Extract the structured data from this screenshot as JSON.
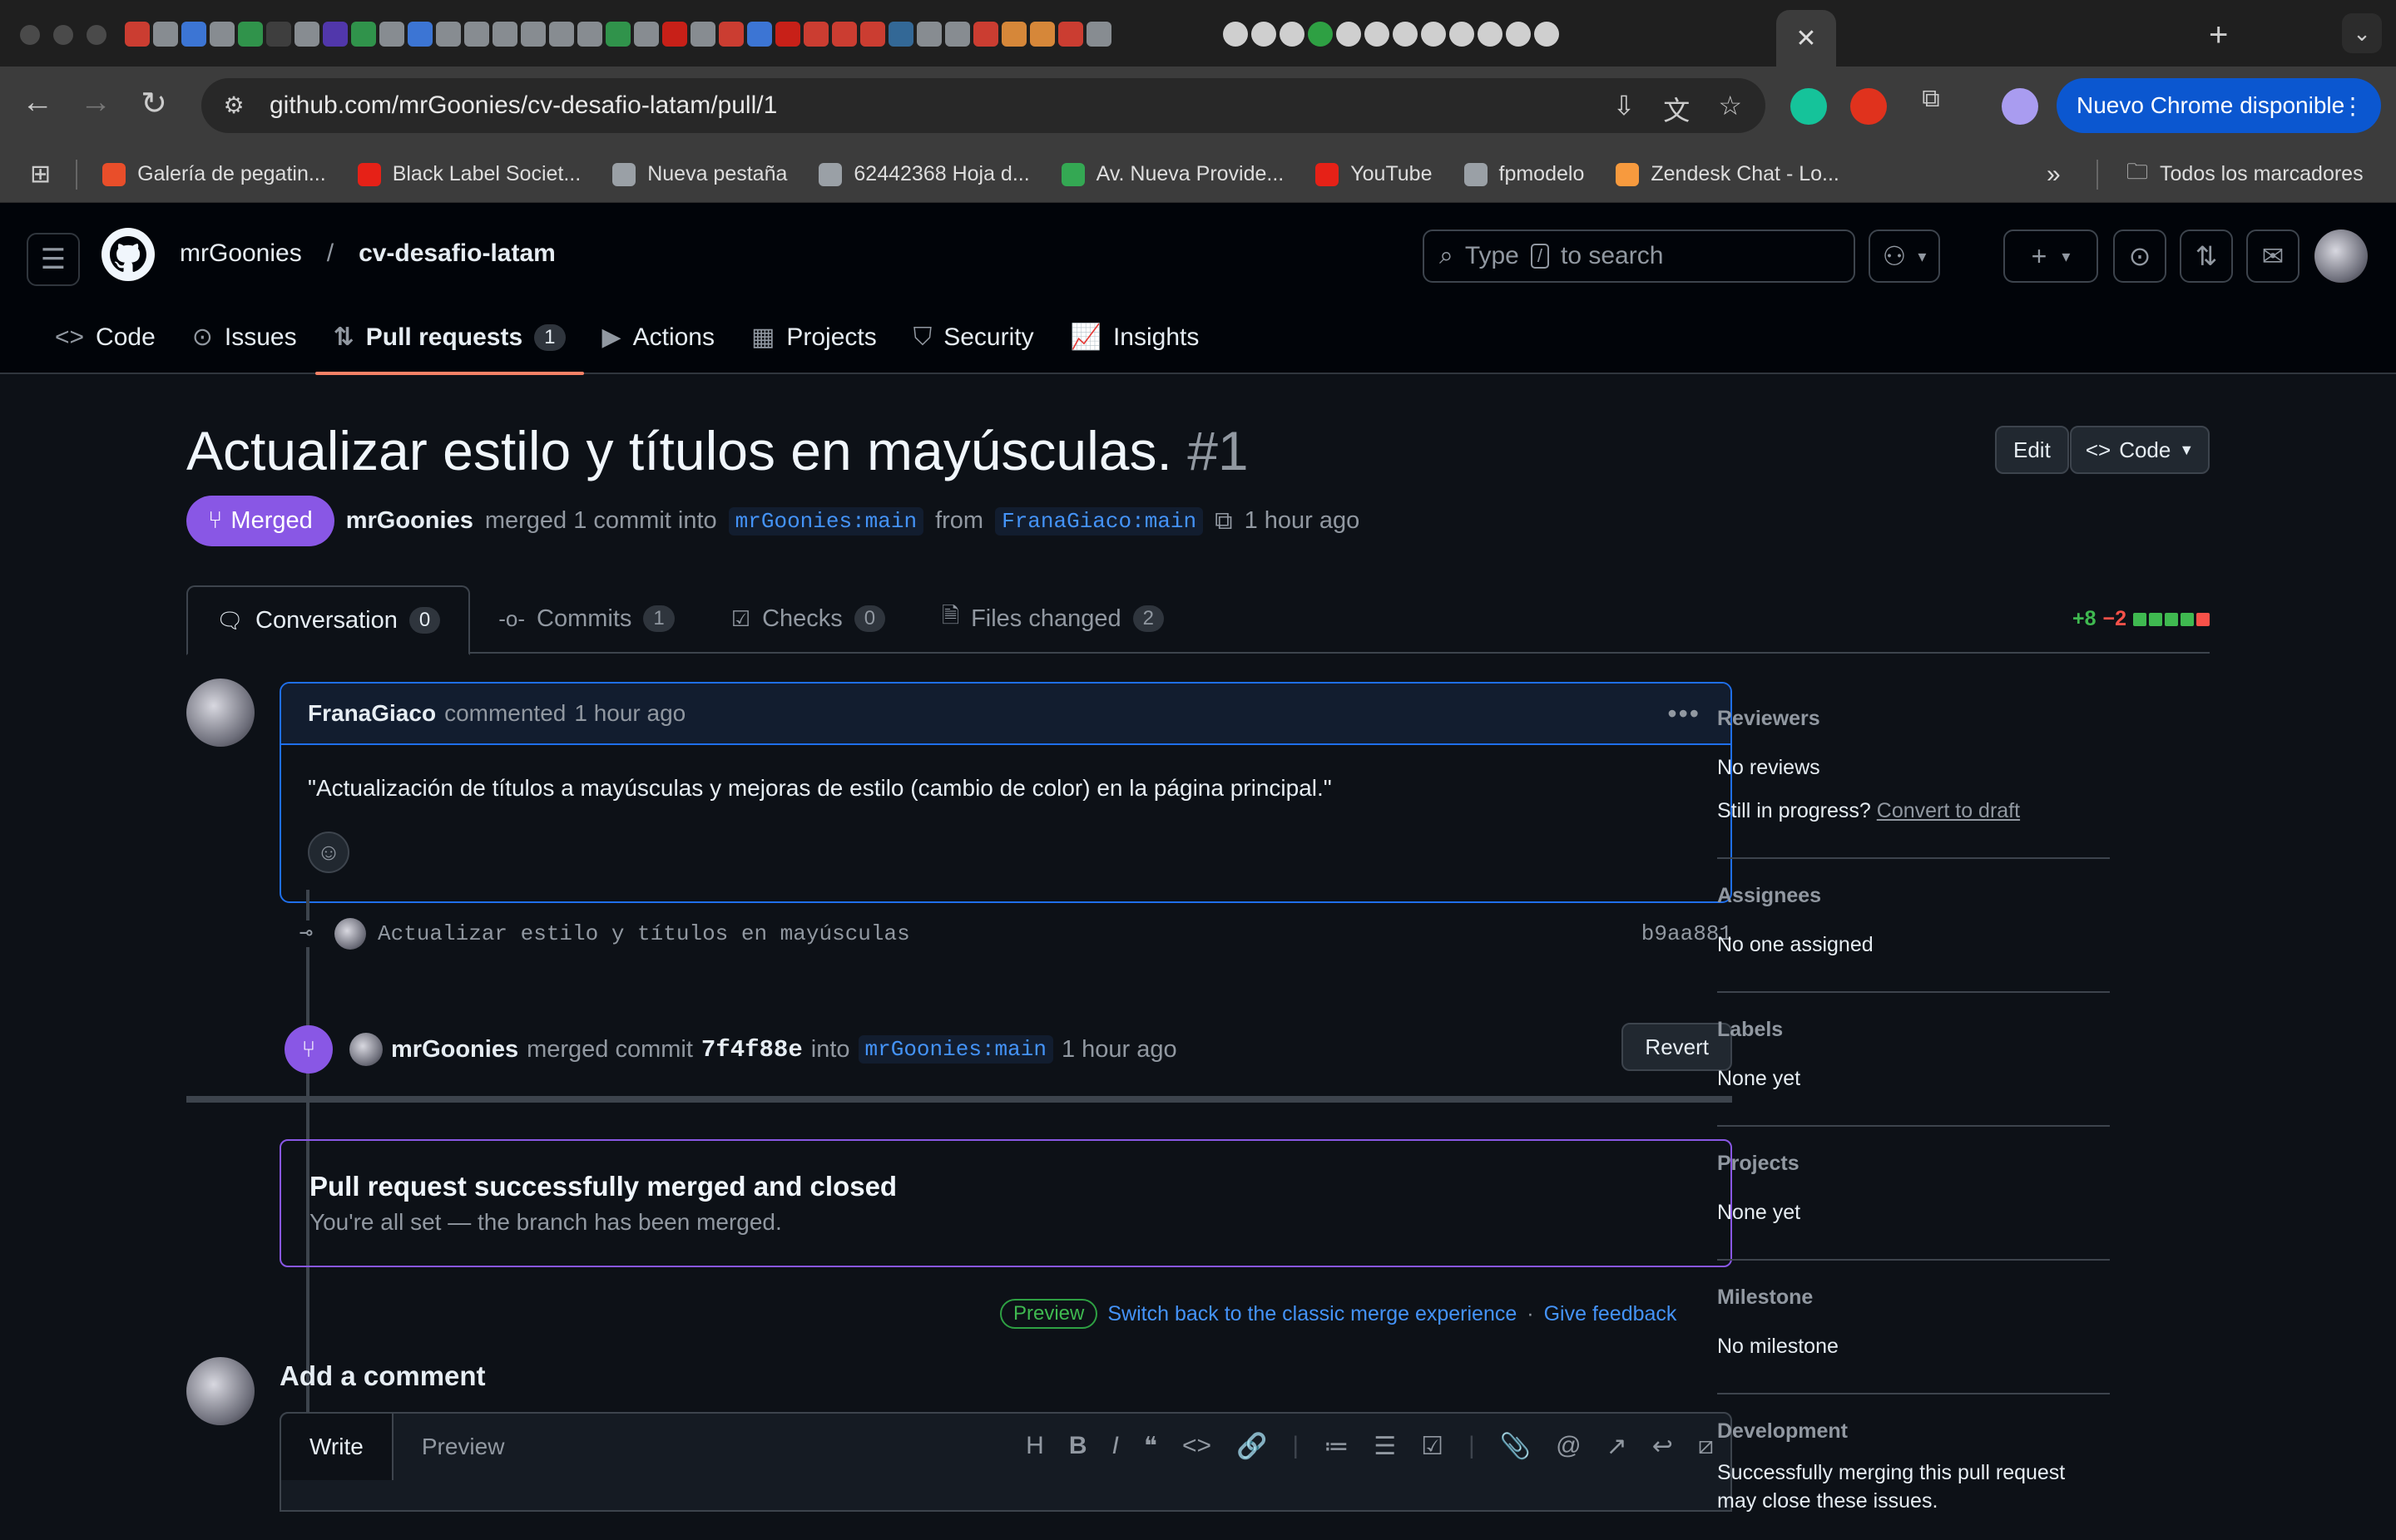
{
  "browser": {
    "url": "github.com/mrGoonies/cv-desafio-latam/pull/1",
    "update_label": "Nuevo Chrome disponible",
    "bookmarks": [
      {
        "label": "Galería de pegatin...",
        "color": "#e94e2a"
      },
      {
        "label": "Black Label Societ...",
        "color": "#e62117"
      },
      {
        "label": "Nueva pestaña",
        "color": "#9aa0a6"
      },
      {
        "label": "62442368 Hoja d...",
        "color": "#9aa0a6"
      },
      {
        "label": "Av. Nueva Provide...",
        "color": "#34a853"
      },
      {
        "label": "YouTube",
        "color": "#e62117"
      },
      {
        "label": "fpmodelo",
        "color": "#9aa0a6"
      },
      {
        "label": "Zendesk Chat - Lo...",
        "color": "#f79a3e"
      }
    ],
    "all_bookmarks": "Todos los marcadores"
  },
  "header": {
    "owner": "mrGoonies",
    "separator": "/",
    "repo": "cv-desafio-latam",
    "search_prefix": "Type",
    "search_key": "/",
    "search_suffix": "to search"
  },
  "repo_nav": [
    {
      "label": "Code",
      "icon": "code-icon",
      "glyph": "<>"
    },
    {
      "label": "Issues",
      "icon": "issue-icon",
      "glyph": "⊙"
    },
    {
      "label": "Pull requests",
      "icon": "pull-request-icon",
      "glyph": "⇅",
      "count": "1",
      "active": true
    },
    {
      "label": "Actions",
      "icon": "play-icon",
      "glyph": "▶"
    },
    {
      "label": "Projects",
      "icon": "table-icon",
      "glyph": "▦"
    },
    {
      "label": "Security",
      "icon": "shield-icon",
      "glyph": "⛉"
    },
    {
      "label": "Insights",
      "icon": "graph-icon",
      "glyph": "📈"
    }
  ],
  "pr": {
    "title": "Actualizar estilo y títulos en mayúsculas.",
    "number": "#1",
    "edit": "Edit",
    "code": "Code",
    "status": "Merged",
    "author": "mrGoonies",
    "merged_text": "merged 1 commit into",
    "base_branch": "mrGoonies:main",
    "from": "from",
    "head_branch": "FranaGiaco:main",
    "time": "1 hour ago"
  },
  "tabs": [
    {
      "label": "Conversation",
      "count": "0",
      "icon": "comment-icon",
      "glyph": "🗨"
    },
    {
      "label": "Commits",
      "count": "1",
      "icon": "commit-icon",
      "glyph": "-o-"
    },
    {
      "label": "Checks",
      "count": "0",
      "icon": "checklist-icon",
      "glyph": "☑"
    },
    {
      "label": "Files changed",
      "count": "2",
      "icon": "file-diff-icon",
      "glyph": "🗎"
    }
  ],
  "diffstat": {
    "added": "+8",
    "removed": "−2"
  },
  "comment": {
    "author": "FranaGiaco",
    "action": "commented",
    "time": "1 hour ago",
    "body": "\"Actualización de títulos a mayúsculas y mejoras de estilo (cambio de color) en la página principal.\""
  },
  "commit": {
    "message": "Actualizar estilo y títulos en mayúsculas",
    "sha": "b9aa881"
  },
  "merge_event": {
    "author": "mrGoonies",
    "text": "merged commit",
    "sha": "7f4f88e",
    "into": "into",
    "branch": "mrGoonies:main",
    "time": "1 hour ago",
    "revert": "Revert"
  },
  "merged_box": {
    "title": "Pull request successfully merged and closed",
    "subtitle": "You're all set — the branch has been merged."
  },
  "preview": {
    "badge": "Preview",
    "link1": "Switch back to the classic merge experience",
    "sep": "·",
    "link2": "Give feedback"
  },
  "add_comment": {
    "title": "Add a comment",
    "write": "Write",
    "preview": "Preview"
  },
  "sidebar": {
    "reviewers_h": "Reviewers",
    "reviewers_v": "No reviews",
    "progress_q": "Still in progress?",
    "convert": "Convert to draft",
    "assignees_h": "Assignees",
    "assignees_v": "No one assigned",
    "labels_h": "Labels",
    "labels_v": "None yet",
    "projects_h": "Projects",
    "projects_v": "None yet",
    "milestone_h": "Milestone",
    "milestone_v": "No milestone",
    "development_h": "Development",
    "development_v": "Successfully merging this pull request may close these issues."
  }
}
